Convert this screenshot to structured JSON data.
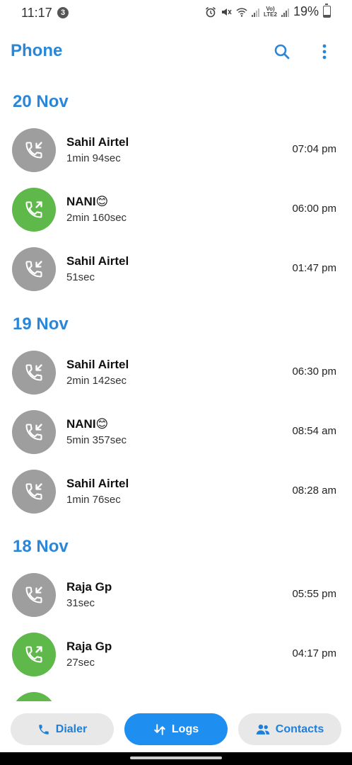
{
  "status_bar": {
    "time": "11:17",
    "notification_count": "3",
    "lte_label_top": "Vo)",
    "lte_label_bottom": "LTE2",
    "battery_text": "19%",
    "battery_level": 0.19
  },
  "header": {
    "title": "Phone"
  },
  "log_groups": [
    {
      "date": "20 Nov",
      "entries": [
        {
          "name": "Sahil Airtel",
          "duration": "1min 94sec",
          "time": "07:04 pm",
          "direction": "incoming"
        },
        {
          "name": "NANI😊",
          "duration": "2min 160sec",
          "time": "06:00 pm",
          "direction": "outgoing"
        },
        {
          "name": "Sahil Airtel",
          "duration": "51sec",
          "time": "01:47 pm",
          "direction": "incoming"
        }
      ]
    },
    {
      "date": "19 Nov",
      "entries": [
        {
          "name": "Sahil Airtel",
          "duration": "2min 142sec",
          "time": "06:30 pm",
          "direction": "incoming"
        },
        {
          "name": "NANI😊",
          "duration": "5min 357sec",
          "time": "08:54 am",
          "direction": "incoming"
        },
        {
          "name": "Sahil Airtel",
          "duration": "1min 76sec",
          "time": "08:28 am",
          "direction": "incoming"
        }
      ]
    },
    {
      "date": "18 Nov",
      "entries": [
        {
          "name": "Raja Gp",
          "duration": "31sec",
          "time": "05:55 pm",
          "direction": "incoming"
        },
        {
          "name": "Raja Gp",
          "duration": "27sec",
          "time": "04:17 pm",
          "direction": "outgoing"
        },
        {
          "name": "",
          "duration": "",
          "time": "",
          "direction": "outgoing"
        }
      ]
    }
  ],
  "bottom_nav": {
    "dialer": "Dialer",
    "logs": "Logs",
    "contacts": "Contacts"
  },
  "colors": {
    "accent": "#2a86d9",
    "incoming": "#9e9e9e",
    "outgoing": "#5fb94a",
    "active_tab": "#1e8ff0"
  }
}
